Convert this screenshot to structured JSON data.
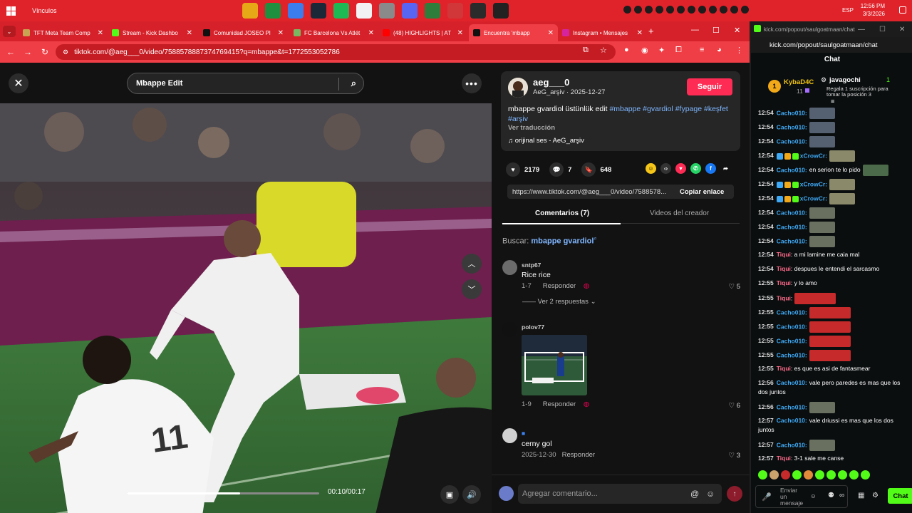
{
  "taskbar": {
    "label": "Vínculos",
    "lang": "ESP",
    "time": "12:56 PM",
    "date": "3/3/2026",
    "apps": [
      {
        "icon": "folder-icon",
        "color": "#e6a817"
      },
      {
        "icon": "chrome-icon",
        "color": "#1e8f3e"
      },
      {
        "icon": "google-drive-icon",
        "color": "#3b7ded"
      },
      {
        "icon": "steam-icon",
        "color": "#1b2838"
      },
      {
        "icon": "spotify-icon",
        "color": "#1db954"
      },
      {
        "icon": "calendar-icon",
        "color": "#f2f2f2"
      },
      {
        "icon": "notes-icon",
        "color": "#8a8a8a"
      },
      {
        "icon": "discord-icon",
        "color": "#5865f2"
      },
      {
        "icon": "chrome-active-icon",
        "color": "#2f7d3a"
      },
      {
        "icon": "riot-icon",
        "color": "#d13639"
      },
      {
        "icon": "valorant-icon",
        "color": "#2b2b2b"
      },
      {
        "icon": "app-icon",
        "color": "#222222"
      }
    ]
  },
  "browser": {
    "tabs": [
      {
        "label": "TFT Meta Team Comp",
        "favicon_color": "#c9a352"
      },
      {
        "label": "Stream - Kick Dashbo",
        "favicon_color": "#53fc18"
      },
      {
        "label": "Comunidad JOSEO Pl",
        "favicon_color": "#111111"
      },
      {
        "label": "FC Barcelona Vs Atlét",
        "favicon_color": "#7bb661"
      },
      {
        "label": "(48) HIGHLIGHTS | AT",
        "favicon_color": "#ff0000"
      },
      {
        "label": "Encuentra 'mbapp",
        "favicon_color": "#111111"
      },
      {
        "label": "Instagram • Mensajes",
        "favicon_color": "#d6249f"
      }
    ],
    "url": "tiktok.com/@aeg___0/video/7588578887374769415?q=mbappe&t=1772553052786"
  },
  "video": {
    "search_value": "Mbappe Edit",
    "progress": 0.59,
    "time": "00:10/00:17"
  },
  "post": {
    "username": "aeg___0",
    "subline": "AeG_arşiv · 2025-12-27",
    "follow": "Seguir",
    "caption": "mbappe gvardiol üstünlük edit",
    "hashtags": [
      "#mbappe",
      "#gvardiol",
      "#fypage",
      "#keşfet",
      "#arşiv"
    ],
    "translate": "Ver traducción",
    "music": "orijinal ses - AeG_arşiv",
    "likes": "2179",
    "comments": "7",
    "saves": "648",
    "link": "https://www.tiktok.com/@aeg___0/video/7588578...",
    "copy": "Copiar enlace",
    "tab_comments": "Comentarios (7)",
    "tab_videos": "Videos del creador",
    "buscar_label": "Buscar:",
    "buscar_query": "mbappe gvardiol",
    "comment_placeholder": "Agregar comentario..."
  },
  "comments": [
    {
      "user": "sntp67",
      "text": "Rice rice",
      "date": "1-7",
      "reply": "Responder",
      "likes": "5",
      "replies": "Ver 2 respuestas"
    },
    {
      "user": "polov77",
      "text": "",
      "date": "1-9",
      "reply": "Responder",
      "likes": "6"
    },
    {
      "user": "",
      "text": "cerny gol",
      "date": "2025-12-30",
      "reply": "Responder",
      "likes": "3"
    }
  ],
  "kick": {
    "window_url": "kick.com/popout/saulgoatmaan/chat",
    "url": "kick.com/popout/saulgoatmaan/chat",
    "chat_label": "Chat",
    "leader_name": "KybaD4C",
    "leader_count": "11",
    "leader2_name": "javagochi",
    "leader2_count": "1",
    "leader2_sub": "Regala 1 suscripción para tomar la posición 3",
    "input_placeholder": "Enviar un mensaje",
    "chat_button": "Chat",
    "messages": [
      {
        "t": "12:54",
        "u": "Cacho010:",
        "c": "#3fa9f5",
        "text": "",
        "emote": "#556070"
      },
      {
        "t": "12:54",
        "u": "Cacho010:",
        "c": "#3fa9f5",
        "text": "",
        "emote": "#556070"
      },
      {
        "t": "12:54",
        "u": "Cacho010:",
        "c": "#3fa9f5",
        "text": "",
        "emote": "#556070"
      },
      {
        "t": "12:54",
        "u": "xCrowCr:",
        "c": "#3fa9f5",
        "text": "",
        "emote": "#8a8a6a",
        "badges": true
      },
      {
        "t": "12:54",
        "u": "Cacho010:",
        "c": "#3fa9f5",
        "text": "en serion te lo pido",
        "emote": "#4a6a4a"
      },
      {
        "t": "12:54",
        "u": "xCrowCr:",
        "c": "#3fa9f5",
        "text": "",
        "emote": "#8a8a6a",
        "badges": true
      },
      {
        "t": "12:54",
        "u": "xCrowCr:",
        "c": "#3fa9f5",
        "text": "",
        "emote": "#8a8a6a",
        "badges": true
      },
      {
        "t": "12:54",
        "u": "Cacho010:",
        "c": "#3fa9f5",
        "text": "",
        "emote": "#6a7060"
      },
      {
        "t": "12:54",
        "u": "Cacho010:",
        "c": "#3fa9f5",
        "text": "",
        "emote": "#6a7060"
      },
      {
        "t": "12:54",
        "u": "Cacho010:",
        "c": "#3fa9f5",
        "text": "",
        "emote": "#6a7060"
      },
      {
        "t": "12:54",
        "u": "Tiqui",
        "c": "#ff6b8b",
        "text": ": a mi lamine me caia mal"
      },
      {
        "t": "12:54",
        "u": "Tiqui",
        "c": "#ff6b8b",
        "text": ": despues le entendi el sarcasmo"
      },
      {
        "t": "12:55",
        "u": "Tiqui",
        "c": "#ff6b8b",
        "text": ": y lo amo"
      },
      {
        "t": "12:55",
        "u": "Tiqui",
        "c": "#ff6b8b",
        "text": ":",
        "emote": "#c62a2a"
      },
      {
        "t": "12:55",
        "u": "Cacho010:",
        "c": "#3fa9f5",
        "text": "",
        "emote": "#c62a2a"
      },
      {
        "t": "12:55",
        "u": "Cacho010:",
        "c": "#3fa9f5",
        "text": "",
        "emote": "#c62a2a"
      },
      {
        "t": "12:55",
        "u": "Cacho010:",
        "c": "#3fa9f5",
        "text": "",
        "emote": "#c62a2a"
      },
      {
        "t": "12:55",
        "u": "Cacho010:",
        "c": "#3fa9f5",
        "text": "",
        "emote": "#c62a2a"
      },
      {
        "t": "12:55",
        "u": "Tiqui",
        "c": "#ff6b8b",
        "text": ": es que es asi de fantasmear"
      },
      {
        "t": "12:56",
        "u": "Cacho010:",
        "c": "#3fa9f5",
        "text": "vale pero paredes es mas que los dos juntos",
        "two_line": true
      },
      {
        "t": "12:56",
        "u": "Cacho010:",
        "c": "#3fa9f5",
        "text": "",
        "emote": "#6a7060"
      },
      {
        "t": "12:57",
        "u": "Cacho010:",
        "c": "#3fa9f5",
        "text": "vale driussi es mas que los dos juntos",
        "two_line": true
      },
      {
        "t": "12:57",
        "u": "Cacho010:",
        "c": "#3fa9f5",
        "text": "",
        "emote": "#6a7060"
      },
      {
        "t": "12:57",
        "u": "Tiqui",
        "c": "#ff6b8b",
        "text": ": 3-1 sale me canse"
      }
    ]
  }
}
